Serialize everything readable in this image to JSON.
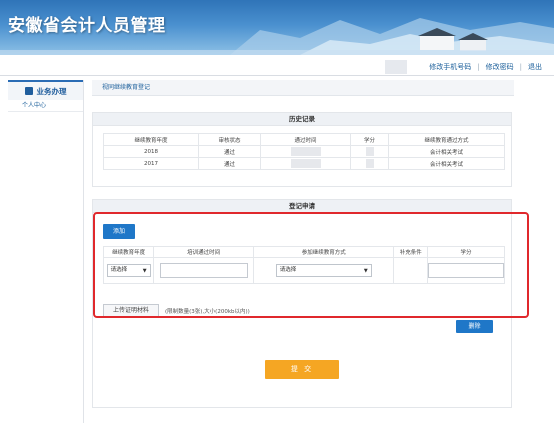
{
  "header": {
    "title": "安徽省会计人员管理"
  },
  "topnav": {
    "change_phone": "修改手机号码",
    "change_password": "修改密码",
    "logout": "退出",
    "sep": "|"
  },
  "sidebar": {
    "section": "业务办理",
    "items": [
      {
        "label": "个人中心"
      }
    ]
  },
  "breadcrumb": "视同继续教育登记",
  "history": {
    "title": "历史记录",
    "columns": [
      "继续教育年度",
      "审核状态",
      "通过时间",
      "学分",
      "继续教育通过方式"
    ],
    "rows": [
      {
        "year": "2018",
        "status": "通过",
        "method": "会计相关考试"
      },
      {
        "year": "2017",
        "status": "通过",
        "method": "会计相关考试"
      }
    ]
  },
  "register": {
    "title": "登记申请",
    "add_label": "添加",
    "columns": [
      "继续教育年度",
      "培训通过时间",
      "参加继续教育方式",
      "补充条件",
      "学分"
    ],
    "year_select": "请选择",
    "method_select": "请选择",
    "upload_label": "上传证明材料",
    "upload_hint": "(限制数量(3张),大小(200kb以内))"
  },
  "actions": {
    "delete_label": "删除",
    "submit_label": "提 交"
  },
  "colors": {
    "primary": "#1f77c8",
    "submit": "#f5a623",
    "highlight": "#e0282c"
  }
}
